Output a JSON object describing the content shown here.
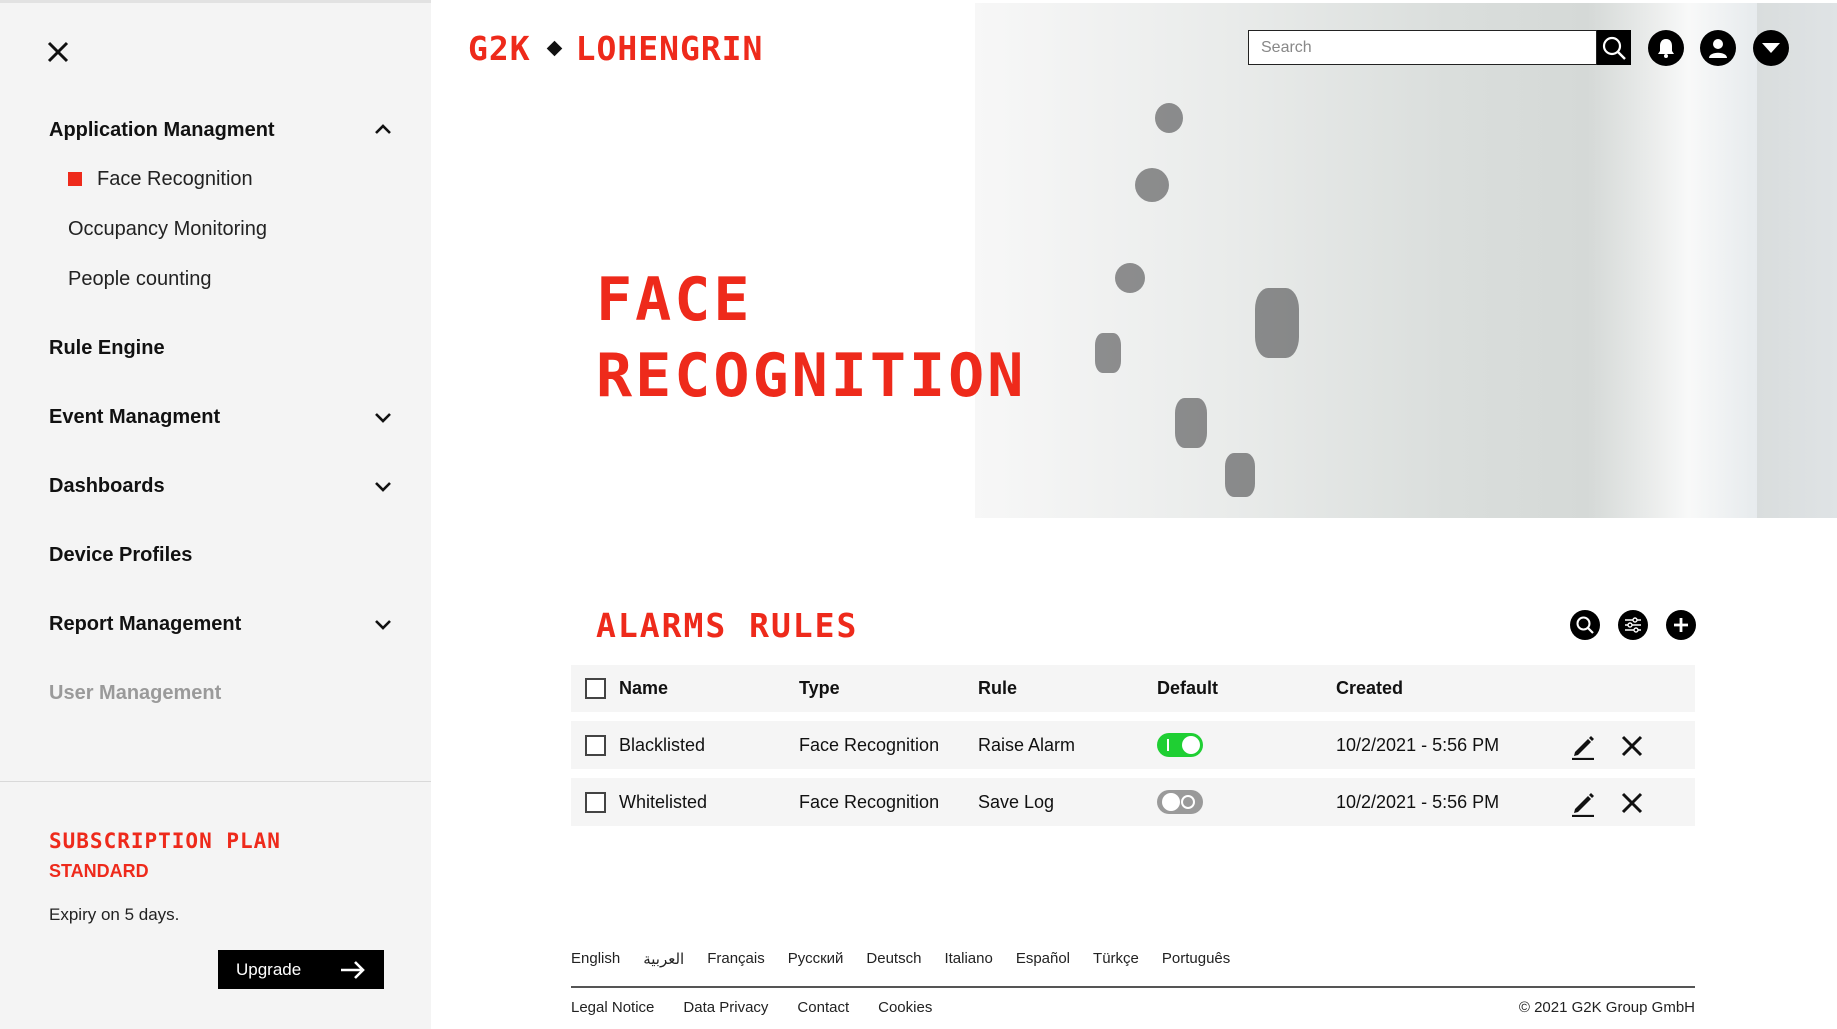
{
  "app": {
    "brand_left": "G2K",
    "brand_right": "LOHENGRIN",
    "accent_color": "#ee2a1b"
  },
  "header": {
    "search_placeholder": "Search",
    "icons": [
      "search-icon",
      "bell-icon",
      "user-icon",
      "chevron-down-icon"
    ]
  },
  "sidebar": {
    "close_icon": "close-icon",
    "items": [
      {
        "label": "Application Managment",
        "icon": "chevron-up-icon"
      },
      {
        "label": "Rule Engine"
      },
      {
        "label": "Event Managment",
        "icon": "chevron-down-icon"
      },
      {
        "label": "Dashboards",
        "icon": "chevron-down-icon"
      },
      {
        "label": "Device Profiles"
      },
      {
        "label": "Report Management",
        "icon": "chevron-down-icon"
      },
      {
        "label": "User Management",
        "state": "disabled"
      }
    ],
    "subitems": [
      {
        "label": "Face Recognition",
        "active": true
      },
      {
        "label": "Occupancy Monitoring"
      },
      {
        "label": "People counting"
      }
    ],
    "subscription": {
      "title": "Subscription Plan",
      "plan": "STANDARD",
      "expiry": "Expiry on 5 days.",
      "upgrade_label": "Upgrade"
    }
  },
  "page": {
    "title_line1": "Face",
    "title_line2": "Recognition"
  },
  "alarms": {
    "title": "Alarms Rules",
    "tools": [
      "search-icon",
      "filter-icon",
      "add-icon"
    ],
    "columns": {
      "name": "Name",
      "type": "Type",
      "rule": "Rule",
      "default": "Default",
      "created": "Created"
    },
    "rows": [
      {
        "name": "Blacklisted",
        "type": "Face Recognition",
        "rule": "Raise Alarm",
        "default": true,
        "created": "10/2/2021 - 5:56 PM"
      },
      {
        "name": "Whitelisted",
        "type": "Face Recognition",
        "rule": "Save Log",
        "default": false,
        "created": "10/2/2021 - 5:56 PM"
      }
    ]
  },
  "footer": {
    "languages": [
      "English",
      "العربية",
      "Français",
      "Русский",
      "Deutsch",
      "Italiano",
      "Español",
      "Türkçe",
      "Português"
    ],
    "links": [
      "Legal Notice",
      "Data Privacy",
      "Contact",
      "Cookies"
    ],
    "copyright": "© 2021 G2K Group GmbH"
  }
}
